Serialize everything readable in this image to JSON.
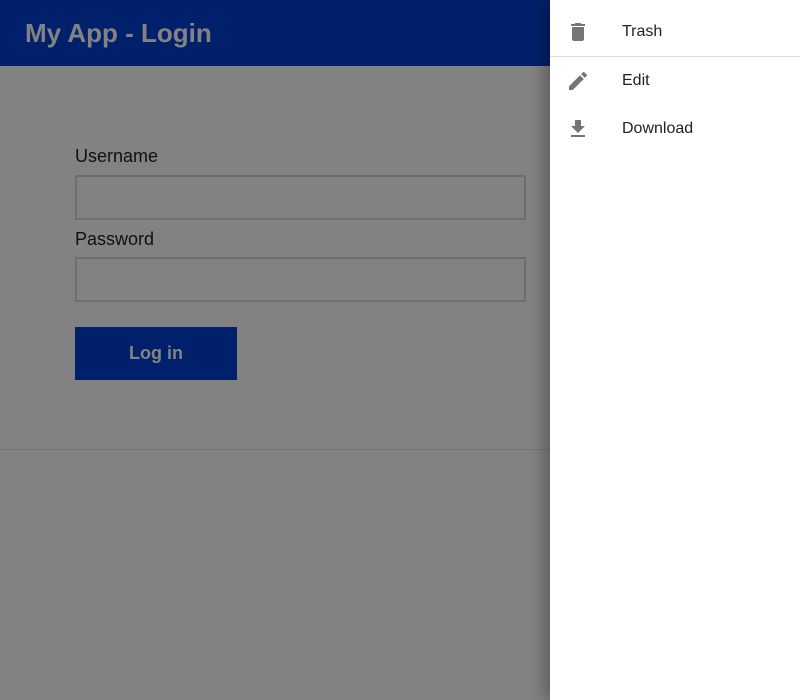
{
  "appbar": {
    "title": "My App - Login"
  },
  "login_form": {
    "username_label": "Username",
    "username_value": "",
    "password_label": "Password",
    "password_value": "",
    "login_button_label": "Log in"
  },
  "drawer_menu": {
    "items": [
      {
        "label": "Trash",
        "icon": "trash-icon"
      },
      {
        "label": "Edit",
        "icon": "pencil-icon"
      },
      {
        "label": "Download",
        "icon": "download-icon"
      }
    ]
  },
  "colors": {
    "brand_primary": "#0040d4",
    "icon_gray": "#757575",
    "scrim": "#000000"
  }
}
